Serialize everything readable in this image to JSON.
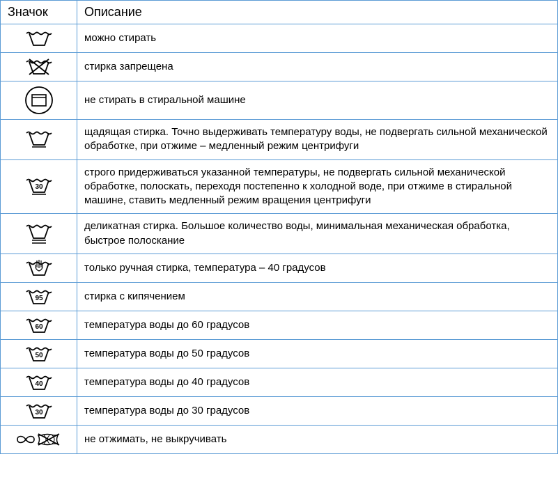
{
  "headers": {
    "icon": "Значок",
    "desc": "Описание"
  },
  "rows": [
    {
      "icon": "wash",
      "desc": "можно стирать"
    },
    {
      "icon": "wash-no",
      "desc": "стирка запрещена"
    },
    {
      "icon": "no-machine",
      "desc": "не стирать в стиральной машине"
    },
    {
      "icon": "wash-1bar",
      "desc": "щадящая стирка. Точно выдерживать температуру воды, не подвергать сильной механической обработке, при отжиме – медленный режим центрифуги"
    },
    {
      "icon": "wash-30-1bar",
      "desc": "строго придерживаться указанной температуры, не подвергать сильной механической обработке, полоскать, переходя постепенно к холодной воде, при отжиме в стиральной машине, ставить медленный режим вращения центрифуги"
    },
    {
      "icon": "wash-2bar",
      "desc": "деликатная стирка. Большое количество воды, минимальная механическая обработка, быстрое полоскание"
    },
    {
      "icon": "handwash",
      "desc": "только ручная стирка, температура – 40 градусов"
    },
    {
      "icon": "wash-95",
      "desc": "стирка с кипячением"
    },
    {
      "icon": "wash-60",
      "desc": "температура воды до 60 градусов"
    },
    {
      "icon": "wash-50",
      "desc": "температура воды до 50 градусов"
    },
    {
      "icon": "wash-40",
      "desc": "температура воды до 40 градусов"
    },
    {
      "icon": "wash-30",
      "desc": "температура воды до 30 градусов"
    },
    {
      "icon": "no-wring",
      "desc": "не отжимать, не выкручивать"
    }
  ]
}
